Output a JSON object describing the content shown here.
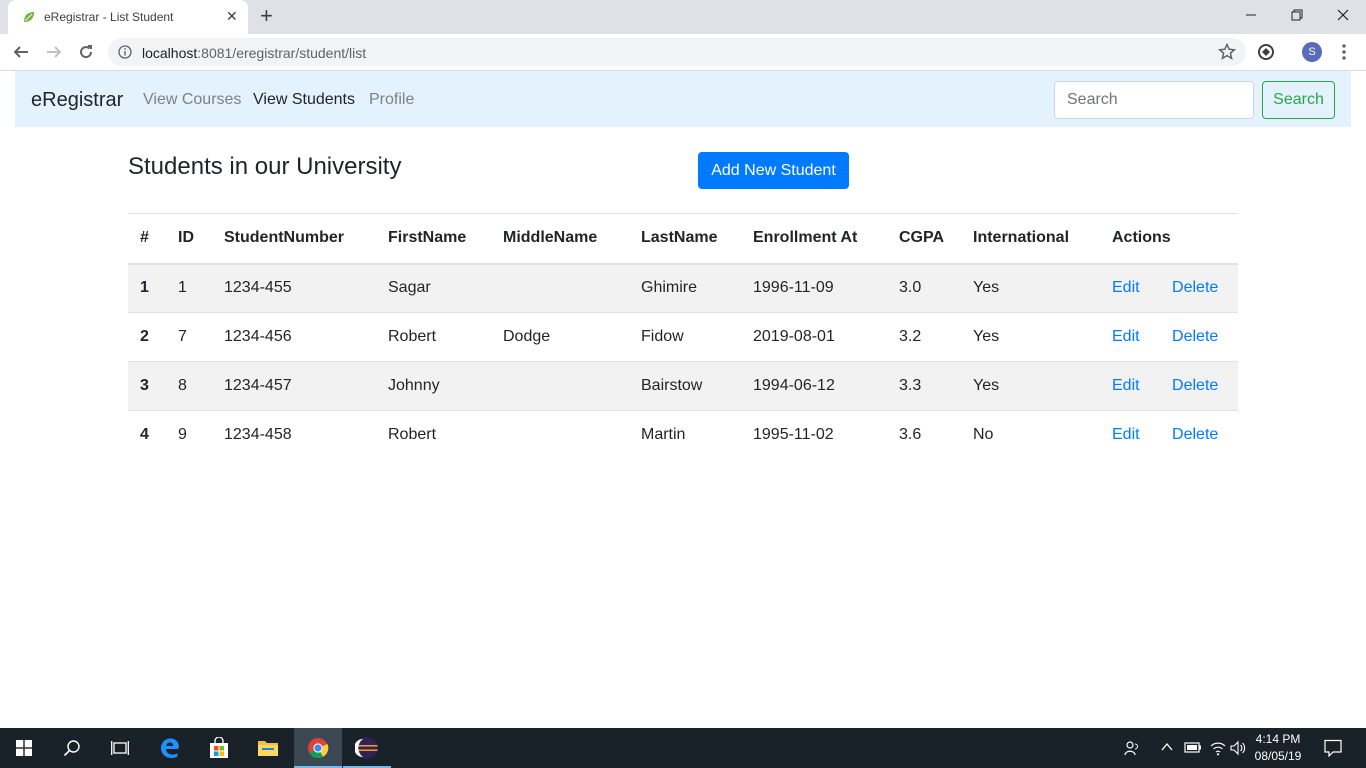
{
  "browser": {
    "tab_title": "eRegistrar - List Student",
    "url_host": "localhost",
    "url_rest": ":8081/eregistrar/student/list",
    "profile_initial": "S"
  },
  "navbar": {
    "brand": "eRegistrar",
    "links": [
      "View Courses",
      "View Students",
      "Profile"
    ],
    "active_link": "View Students",
    "search_placeholder": "Search",
    "search_button": "Search"
  },
  "page": {
    "heading": "Students in our University",
    "add_button": "Add New Student"
  },
  "table": {
    "headers": [
      "#",
      "ID",
      "StudentNumber",
      "FirstName",
      "MiddleName",
      "LastName",
      "Enrollment At",
      "CGPA",
      "International",
      "Actions"
    ],
    "rows": [
      {
        "num": "1",
        "id": "1",
        "student_number": "1234-455",
        "first": "Sagar",
        "middle": "",
        "last": "Ghimire",
        "enrolled": "1996-11-09",
        "cgpa": "3.0",
        "international": "Yes",
        "edit": "Edit",
        "delete": "Delete"
      },
      {
        "num": "2",
        "id": "7",
        "student_number": "1234-456",
        "first": "Robert",
        "middle": "Dodge",
        "last": "Fidow",
        "enrolled": "2019-08-01",
        "cgpa": "3.2",
        "international": "Yes",
        "edit": "Edit",
        "delete": "Delete"
      },
      {
        "num": "3",
        "id": "8",
        "student_number": "1234-457",
        "first": "Johnny",
        "middle": "",
        "last": "Bairstow",
        "enrolled": "1994-06-12",
        "cgpa": "3.3",
        "international": "Yes",
        "edit": "Edit",
        "delete": "Delete"
      },
      {
        "num": "4",
        "id": "9",
        "student_number": "1234-458",
        "first": "Robert",
        "middle": "",
        "last": "Martin",
        "enrolled": "1995-11-02",
        "cgpa": "3.6",
        "international": "No",
        "edit": "Edit",
        "delete": "Delete"
      }
    ]
  },
  "taskbar": {
    "time": "4:14 PM",
    "date": "08/05/19"
  },
  "colors": {
    "primary": "#007bff",
    "success": "#28a745",
    "navbar_bg": "#e3f2fd",
    "taskbar_bg": "#1a2229"
  },
  "icons": {
    "tab_favicon": "spring-leaf-icon",
    "window_controls": [
      "minimize-icon",
      "maximize-icon",
      "close-icon"
    ],
    "toolbar": [
      "back-icon",
      "forward-icon",
      "reload-icon",
      "info-icon",
      "star-icon",
      "sync-icon",
      "menu-icon"
    ],
    "taskbar": [
      "windows-start-icon",
      "search-icon",
      "task-view-icon",
      "edge-icon",
      "store-icon",
      "file-explorer-icon",
      "chrome-icon",
      "eclipse-icon"
    ],
    "tray": [
      "people-icon",
      "chevron-up-icon",
      "battery-icon",
      "wifi-icon",
      "volume-icon",
      "notification-icon"
    ]
  }
}
